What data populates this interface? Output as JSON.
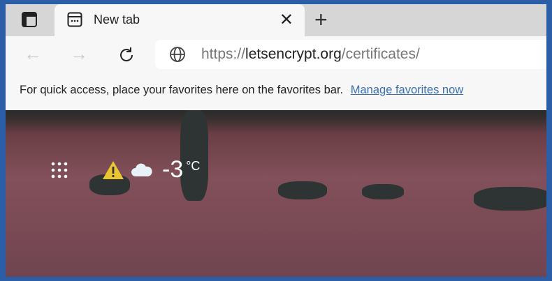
{
  "tab": {
    "title": "New tab"
  },
  "address": {
    "scheme": "https://",
    "domain": "letsencrypt.org",
    "path": "/certificates/"
  },
  "favorites_bar": {
    "message": "For quick access, place your favorites here on the favorites bar.",
    "link": "Manage favorites now"
  },
  "weather": {
    "temperature": "-3",
    "unit": "°C"
  }
}
